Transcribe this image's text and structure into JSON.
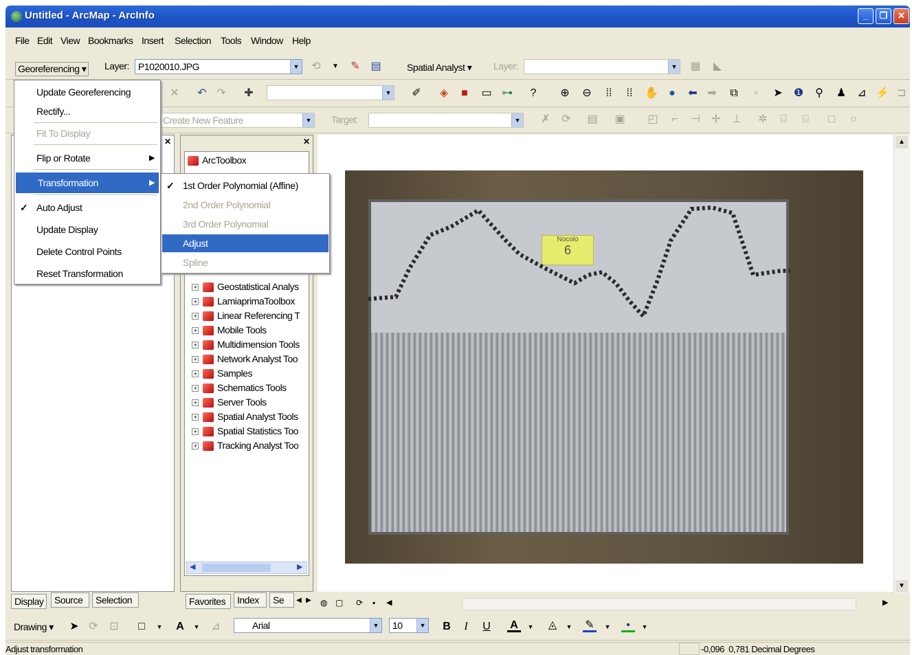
{
  "window": {
    "title": "Untitled - ArcMap - ArcInfo"
  },
  "menubar": [
    "File",
    "Edit",
    "View",
    "Bookmarks",
    "Insert",
    "Selection",
    "Tools",
    "Window",
    "Help"
  ],
  "georef_toolbar": {
    "menu_label": "Georeferencing",
    "layer_label": "Layer:",
    "layer_value": "P1020010.JPG",
    "spatial_analyst_label": "Spatial Analyst",
    "spatial_layer_label": "Layer:"
  },
  "editor_toolbar": {
    "task_value": "Create New Feature",
    "target_label": "Target:"
  },
  "georef_menu": {
    "items": [
      {
        "label": "Update Georeferencing",
        "enabled": true
      },
      {
        "label": "Rectify...",
        "enabled": true
      },
      {
        "label": "Fit To Display",
        "enabled": false
      },
      {
        "label": "Flip or Rotate",
        "enabled": true,
        "submenu": true
      },
      {
        "label": "Transformation",
        "enabled": true,
        "submenu": true,
        "selected": true
      },
      {
        "label": "Auto Adjust",
        "enabled": true,
        "checked": true
      },
      {
        "label": "Update Display",
        "enabled": true
      },
      {
        "label": "Delete Control Points",
        "enabled": true
      },
      {
        "label": "Reset Transformation",
        "enabled": true
      }
    ]
  },
  "transformation_menu": {
    "items": [
      {
        "label": "1st Order Polynomial (Affine)",
        "enabled": true,
        "checked": true
      },
      {
        "label": "2nd Order Polynomial",
        "enabled": false
      },
      {
        "label": "3rd Order Polynomial",
        "enabled": false
      },
      {
        "label": "Adjust",
        "enabled": true,
        "selected": true
      },
      {
        "label": "Spline",
        "enabled": false
      }
    ]
  },
  "toc": {
    "tabs": [
      "Display",
      "Source",
      "Selection"
    ]
  },
  "arctoolbox": {
    "root": "ArcToolbox",
    "items": [
      "Geostatistical Analys",
      "LamiaprimaToolbox",
      "Linear Referencing T",
      "Mobile Tools",
      "Multidimension Tools",
      "Network Analyst Too",
      "Samples",
      "Schematics Tools",
      "Server Tools",
      "Spatial Analyst Tools",
      "Spatial Statistics Too",
      "Tracking Analyst Too"
    ],
    "tabs": [
      "Favorites",
      "Index",
      "Se"
    ]
  },
  "photo": {
    "card_text": "Nocolo",
    "card_number": "6"
  },
  "drawing_toolbar": {
    "label": "Drawing",
    "font_name": "Arial",
    "font_size": "10",
    "bold": "B",
    "italic": "I",
    "underline": "U"
  },
  "status": {
    "message": "Adjust transformation",
    "coords": "-0,096  0,781 Decimal Degrees"
  }
}
